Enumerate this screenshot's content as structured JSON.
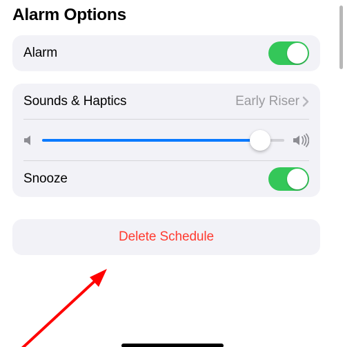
{
  "title": "Alarm Options",
  "alarm": {
    "label": "Alarm",
    "on": true
  },
  "sounds": {
    "label": "Sounds & Haptics",
    "value": "Early Riser"
  },
  "volume": {
    "percent": 90
  },
  "snooze": {
    "label": "Snooze",
    "on": true
  },
  "delete": {
    "label": "Delete Schedule"
  }
}
